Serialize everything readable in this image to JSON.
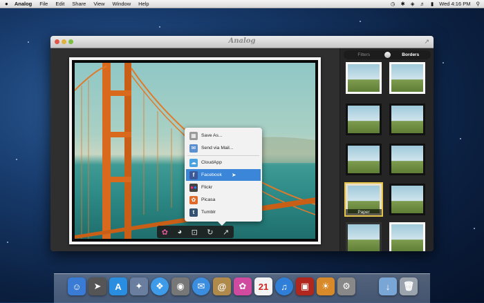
{
  "menubar": {
    "apple": "",
    "app_name": "Analog",
    "menus": [
      "File",
      "Edit",
      "Share",
      "View",
      "Window",
      "Help"
    ],
    "clock": "Wed 4:16 PM"
  },
  "window": {
    "title": "Analog"
  },
  "share_menu": {
    "items": [
      {
        "label": "Save As...",
        "icon": "save-icon",
        "color": "#9a9a9a"
      },
      {
        "label": "Send via Mail...",
        "icon": "mail-icon",
        "color": "#5b8fd0"
      },
      {
        "label": "CloudApp",
        "icon": "cloud-icon",
        "color": "#4aa3e0"
      },
      {
        "label": "Facebook",
        "icon": "facebook-icon",
        "color": "#3b5998",
        "selected": true
      },
      {
        "label": "Flickr",
        "icon": "flickr-icon",
        "color": "#444"
      },
      {
        "label": "Picasa",
        "icon": "picasa-icon",
        "color": "#e06a2b"
      },
      {
        "label": "Tumblr",
        "icon": "tumblr-icon",
        "color": "#34526f"
      }
    ]
  },
  "side_panel": {
    "tab_filters": "Filters",
    "tab_borders": "Borders",
    "active_tab": "Borders",
    "selected_thumb_caption": "Paper"
  },
  "colors": {
    "accent": "#3b86d9",
    "selection_border": "#e5c44b"
  }
}
